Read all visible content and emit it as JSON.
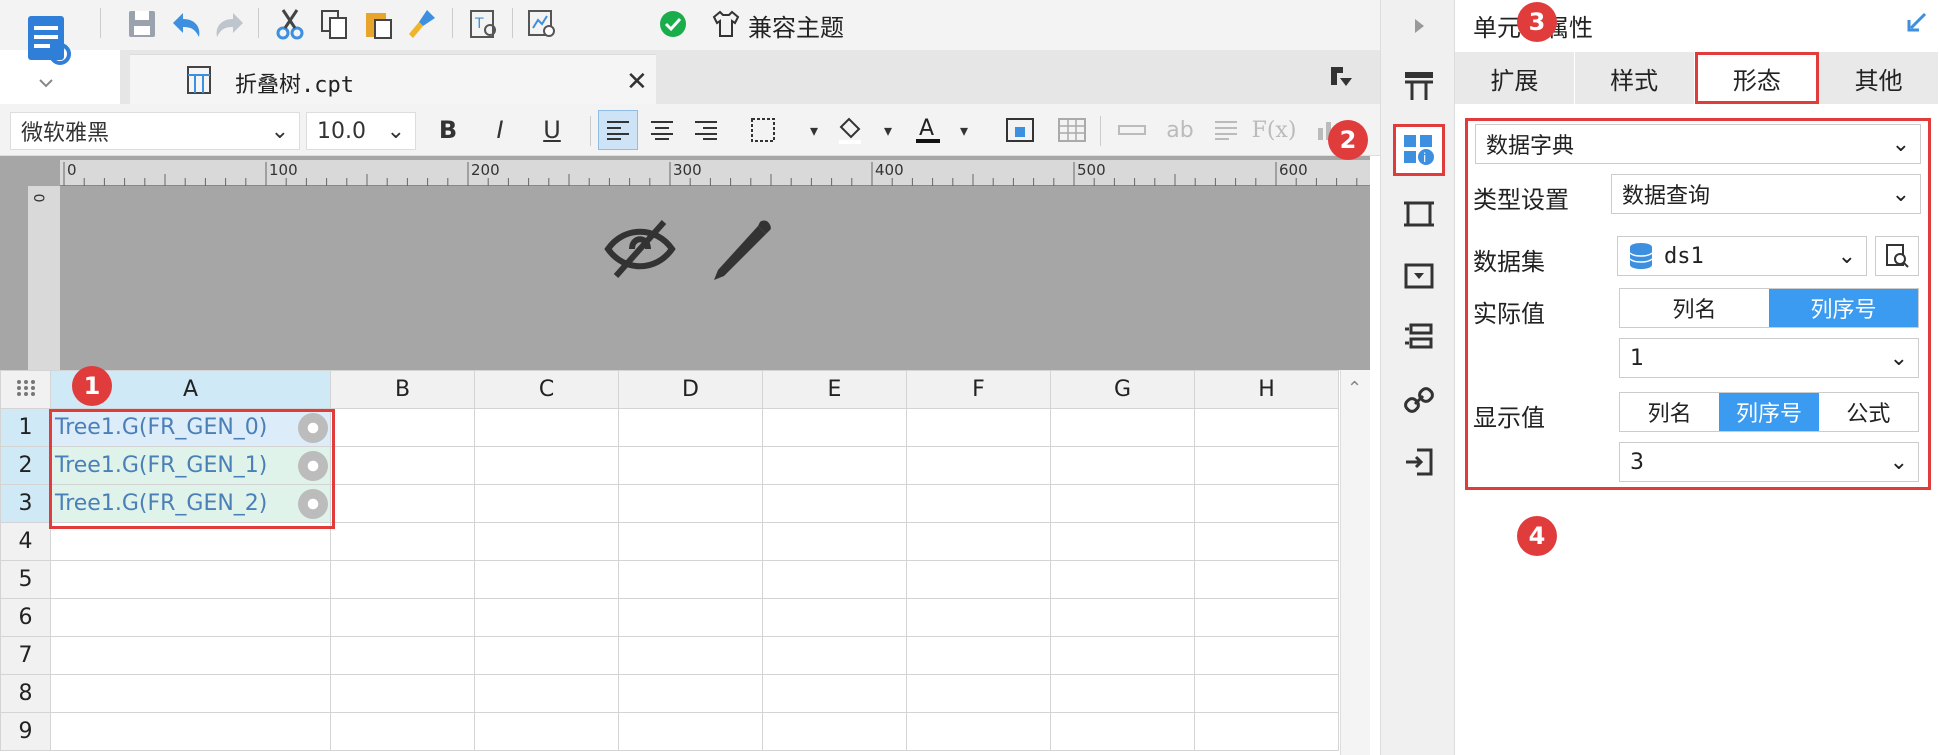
{
  "toolbar": {
    "theme_label": "兼容主题"
  },
  "document": {
    "tab_title": "折叠树.cpt"
  },
  "format_toolbar": {
    "font_name": "微软雅黑",
    "font_size": "10.0"
  },
  "ruler": {
    "marks": [
      "0",
      "100",
      "200",
      "300",
      "400",
      "500",
      "600"
    ],
    "vertical_mark": "0"
  },
  "sheet": {
    "columns": [
      "A",
      "B",
      "C",
      "D",
      "E",
      "F",
      "G",
      "H"
    ],
    "rows": [
      "1",
      "2",
      "3",
      "4",
      "5",
      "6",
      "7",
      "8",
      "9"
    ],
    "cells": [
      "Tree1.G(FR_GEN_0)",
      "Tree1.G(FR_GEN_1)",
      "Tree1.G(FR_GEN_2)"
    ]
  },
  "panel": {
    "title": "单元格属性",
    "tabs": [
      "扩展",
      "样式",
      "形态",
      "其他"
    ],
    "active_tab": "形态",
    "widget_type": "数据字典",
    "type_setting_label": "类型设置",
    "type_setting_value": "数据查询",
    "dataset_label": "数据集",
    "dataset_value": "ds1",
    "actual_value_label": "实际值",
    "actual_value_options": [
      "列名",
      "列序号"
    ],
    "actual_value_selected": "列序号",
    "actual_value_index": "1",
    "display_value_label": "显示值",
    "display_value_options": [
      "列名",
      "列序号",
      "公式"
    ],
    "display_value_selected": "列序号",
    "display_value_index": "3"
  },
  "badges": [
    "1",
    "2",
    "3",
    "4"
  ],
  "colors": {
    "accent": "#3b9bf0",
    "highlight": "#e03c3c"
  }
}
